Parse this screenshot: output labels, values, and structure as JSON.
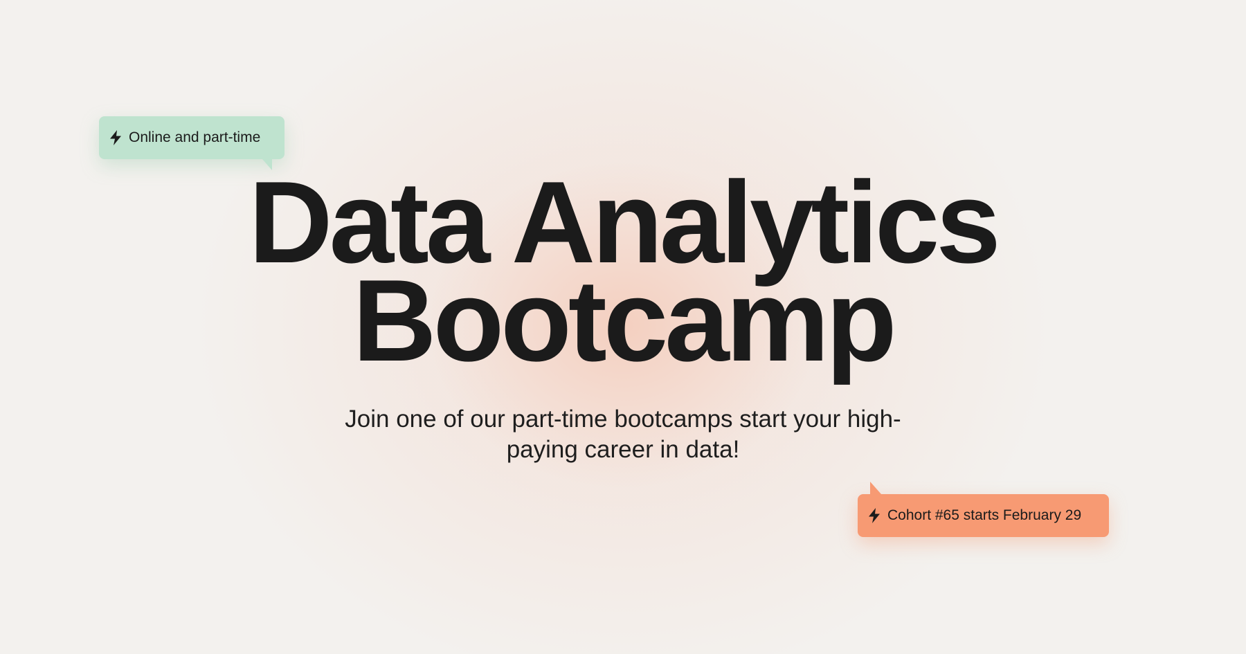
{
  "badges": {
    "top": {
      "label": "Online and part-time",
      "icon": "lightning-bolt-icon",
      "color": "#bfe3cf"
    },
    "bottom": {
      "label": "Cohort #65 starts February 29",
      "icon": "lightning-bolt-icon",
      "color": "#f79a73"
    }
  },
  "hero": {
    "title_line1": "Data Analytics",
    "title_line2": "Bootcamp",
    "subtitle": "Join one of our part-time bootcamps start your high-paying career in data!"
  },
  "colors": {
    "background": "#f3f1ee",
    "glow": "#f4c4b0",
    "text": "#1b1b1b"
  }
}
